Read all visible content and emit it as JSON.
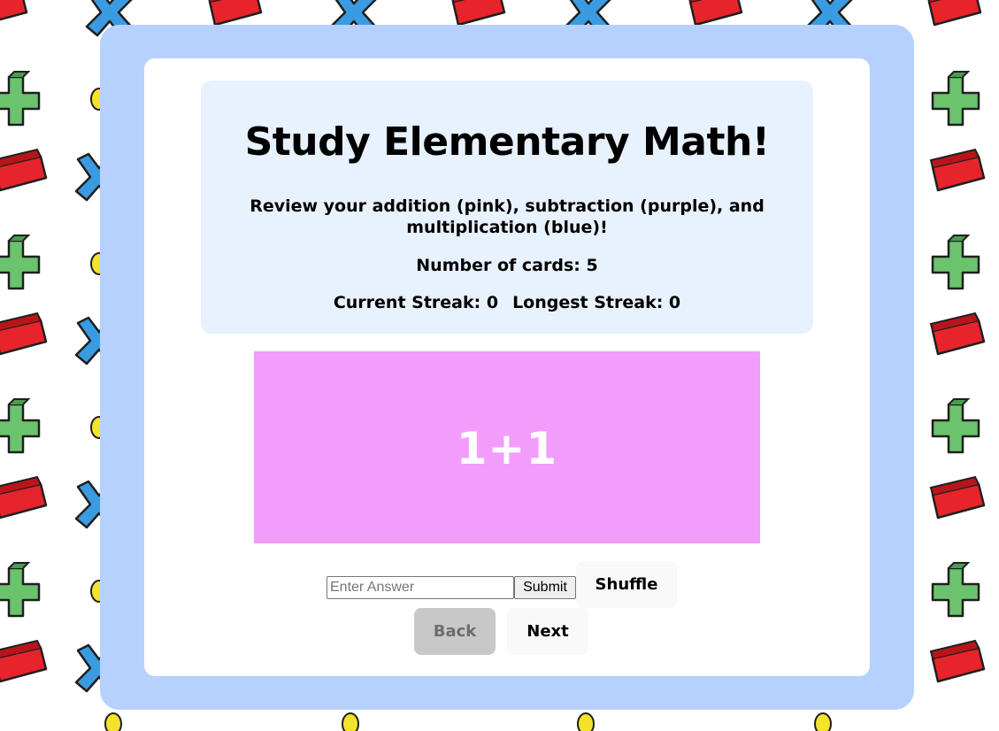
{
  "header": {
    "title": "Study Elementary Math!",
    "subtitle": "Review your addition (pink), subtraction (purple), and multiplication (blue)!",
    "card_count": "Number of cards: 5",
    "current_streak": "Current Streak: 0",
    "longest_streak": "Longest Streak: 0"
  },
  "flashcard": {
    "question": "1+1",
    "color": "#f29cfc"
  },
  "answer": {
    "placeholder": "Enter Answer",
    "value": "",
    "submit_label": "Submit"
  },
  "controls": {
    "shuffle_label": "Shuffle",
    "back_label": "Back",
    "next_label": "Next"
  },
  "colors": {
    "frame": "#b6d1fe",
    "header_panel": "#e8f1fe",
    "card_background": "#ffffff",
    "back_disabled": "#c8c8c8"
  },
  "background_icons": [
    "multiply-icon",
    "minus-icon",
    "plus-icon",
    "divide-icon"
  ]
}
